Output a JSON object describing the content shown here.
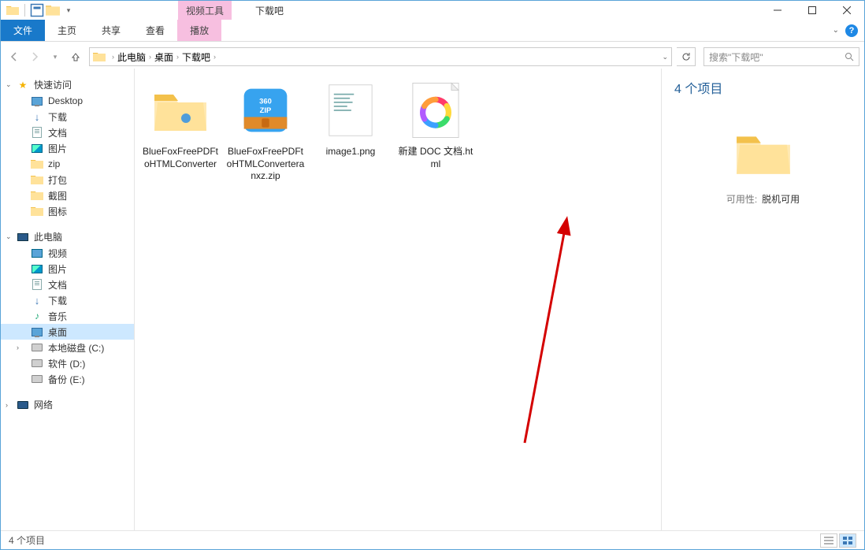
{
  "window": {
    "context_tab": "视频工具",
    "title": "下载吧"
  },
  "ribbon": {
    "file": "文件",
    "home": "主页",
    "share": "共享",
    "view": "查看",
    "play": "播放"
  },
  "address": {
    "crumbs": [
      "此电脑",
      "桌面",
      "下载吧"
    ],
    "search_placeholder": "搜索\"下载吧\""
  },
  "sidebar": {
    "quick": "快速访问",
    "quick_items": [
      "Desktop",
      "下载",
      "文档",
      "图片",
      "zip",
      "打包",
      "截图",
      "图标"
    ],
    "thispc": "此电脑",
    "pc_items": [
      "视频",
      "图片",
      "文档",
      "下载",
      "音乐",
      "桌面",
      "本地磁盘 (C:)",
      "软件 (D:)",
      "备份 (E:)"
    ],
    "network": "网络"
  },
  "files": [
    {
      "name": "BlueFoxFreePDFtoHTMLConverter",
      "type": "folder"
    },
    {
      "name": "BlueFoxFreePDFtoHTMLConverteranxz.zip",
      "type": "zip"
    },
    {
      "name": "image1.png",
      "type": "image"
    },
    {
      "name": "新建 DOC 文档.html",
      "type": "html"
    }
  ],
  "details": {
    "count_label": "4 个项目",
    "avail_label": "可用性:",
    "avail_value": "脱机可用"
  },
  "status": {
    "text": "4 个项目"
  }
}
